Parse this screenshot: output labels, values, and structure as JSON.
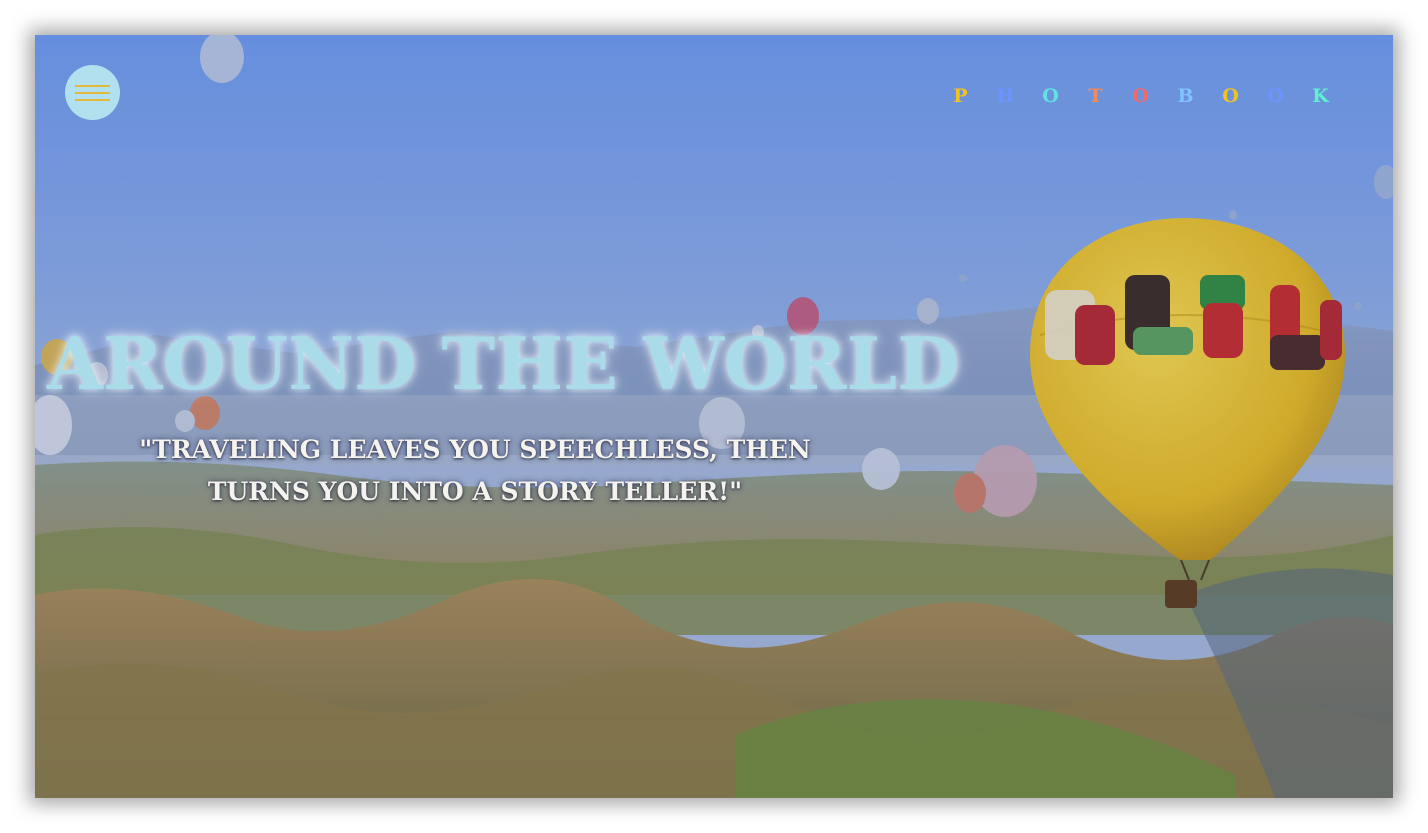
{
  "menu": {
    "icon": "hamburger-menu-icon"
  },
  "brand": {
    "letters": [
      {
        "char": "P",
        "color": "#f2c31f"
      },
      {
        "char": "H",
        "color": "#6a95ff"
      },
      {
        "char": "O",
        "color": "#5ee3e0"
      },
      {
        "char": "T",
        "color": "#f28a5a"
      },
      {
        "char": "O",
        "color": "#f06a6a"
      },
      {
        "char": "B",
        "color": "#7fc3ff"
      },
      {
        "char": "O",
        "color": "#f2c31f"
      },
      {
        "char": "O",
        "color": "#6a95ff"
      },
      {
        "char": "K",
        "color": "#5ef0d0"
      }
    ]
  },
  "hero": {
    "title": "AROUND THE WORLD",
    "quote": "\"TRAVELING LEAVES YOU SPEECHLESS, THEN TURNS YOU INTO A STORY TELLER!\""
  },
  "background": {
    "image": "hot-air-balloons-over-canyon-landscape"
  },
  "colors": {
    "title": "#a9dbe8",
    "menu_bg": "#b3e0ee",
    "menu_lines": "#e2b93a",
    "quote": "#f4f3ee"
  }
}
